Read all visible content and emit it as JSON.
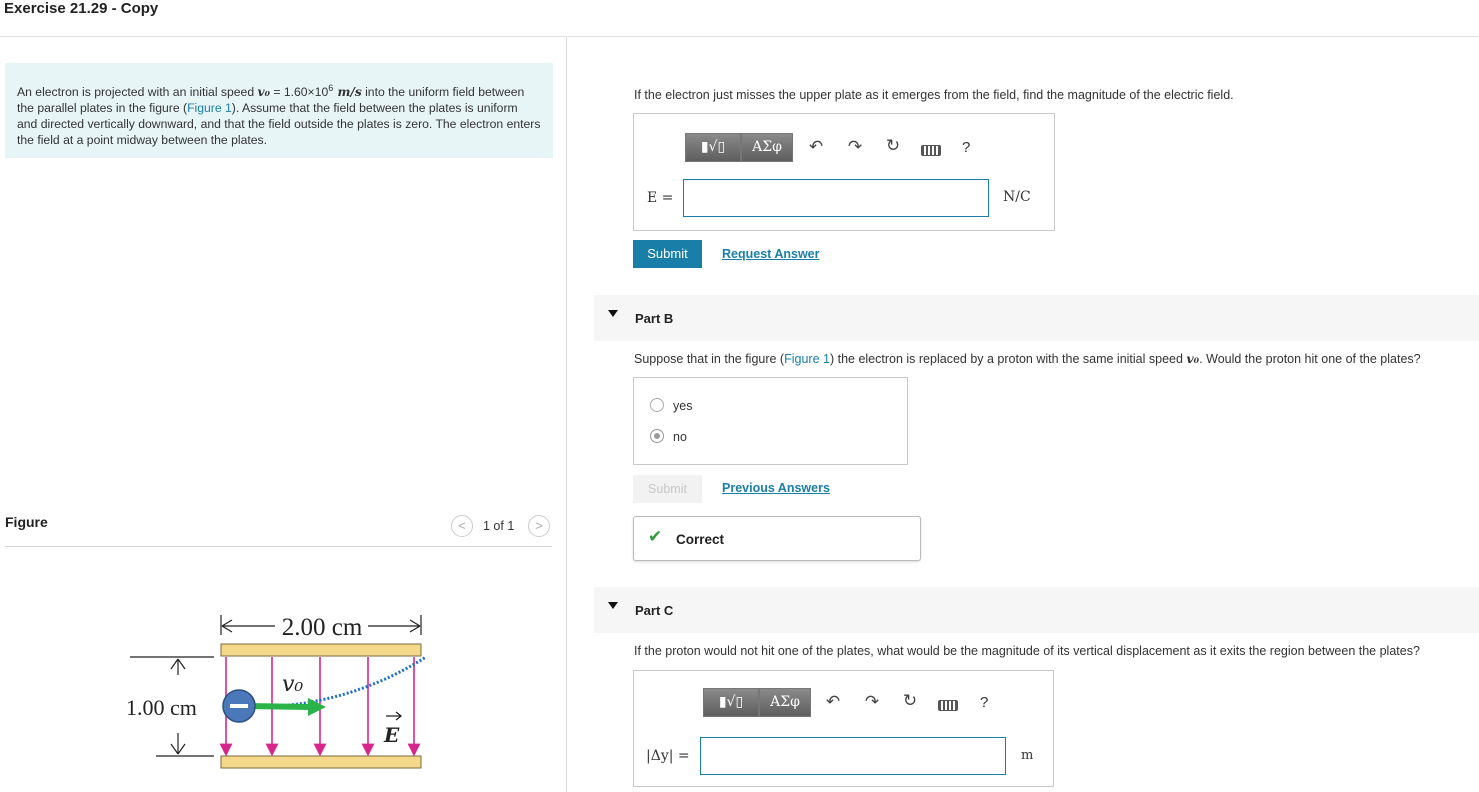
{
  "page": {
    "title": "Exercise 21.29 - Copy"
  },
  "problem": {
    "text_before": "An electron is projected with an initial speed ",
    "v0_symbol": "v₀",
    "text_eq": " = 1.60×10",
    "exp": "6",
    "unit": " m/s",
    "text_mid": " into the uniform field between the parallel plates in the figure (",
    "figure_link": "Figure 1",
    "text_after": "). Assume that the field between the plates is uniform and directed vertically downward, and that the field outside the plates is zero. The electron enters the field at a point midway between the plates."
  },
  "figure": {
    "label": "Figure",
    "count": "1 of 1",
    "width_label": "2.00 cm",
    "height_label": "1.00 cm",
    "v0_label": "v₀",
    "e_label": "E",
    "colors": {
      "plate": "#f5d98a",
      "field": "#d6268c",
      "arrow": "#2bb34a",
      "path": "#1a6fc9",
      "electron": "#4a78b8"
    }
  },
  "partA": {
    "question": "If the electron just misses the upper plate as it emerges from the field, find the magnitude of the electric field.",
    "toolbar": {
      "templates_label": "▮√▯",
      "greek_label": "ΑΣφ",
      "help_label": "?"
    },
    "var_label": "E =",
    "unit": "N/C",
    "input_value": "",
    "submit_label": "Submit",
    "request_label": "Request Answer"
  },
  "partB": {
    "title": "Part B",
    "question_before": "Suppose that in the figure (",
    "figure_link": "Figure 1",
    "question_after": ") the electron is replaced by a proton with the same initial speed ",
    "v0_symbol": "v₀",
    "question_end": ". Would the proton hit one of the plates?",
    "options": [
      {
        "label": "yes",
        "checked": false
      },
      {
        "label": "no",
        "checked": true
      }
    ],
    "submit_label": "Submit",
    "previous_label": "Previous Answers",
    "feedback": "Correct"
  },
  "partC": {
    "title": "Part C",
    "question": "If the proton would not hit one of the plates, what would be the magnitude of its vertical displacement as it exits the region between the plates?",
    "toolbar": {
      "templates_label": "▮√▯",
      "greek_label": "ΑΣφ",
      "help_label": "?"
    },
    "var_label": "|Δy| =",
    "unit": "m",
    "input_value": ""
  }
}
